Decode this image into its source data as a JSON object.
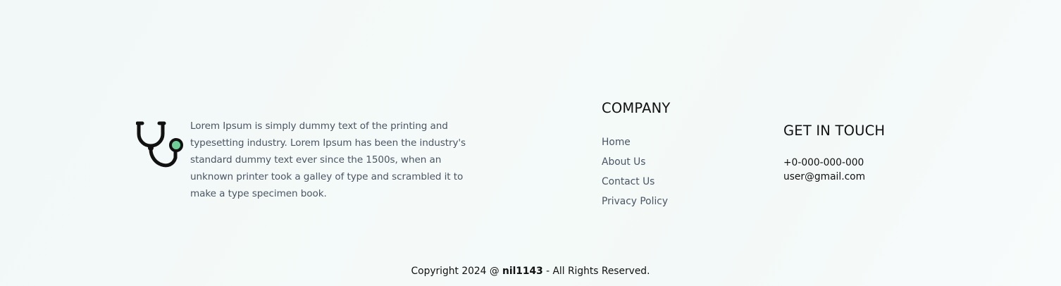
{
  "brand": {
    "logo_icon": "stethoscope-icon",
    "description": "Lorem Ipsum is simply dummy text of the printing and typesetting industry. Lorem Ipsum has been the industry's standard dummy text ever since the 1500s, when an unknown printer took a galley of type and scrambled it to make a type specimen book."
  },
  "company": {
    "heading": "COMPANY",
    "links": [
      {
        "label": "Home"
      },
      {
        "label": "About Us"
      },
      {
        "label": "Contact Us"
      },
      {
        "label": "Privacy Policy"
      }
    ]
  },
  "contact": {
    "heading": "GET IN TOUCH",
    "phone": "+0-000-000-000",
    "email": "user@gmail.com"
  },
  "footer": {
    "copyright_prefix": "Copyright 2024 @",
    "copyright_brand": "nil1143",
    "copyright_suffix": "- All Rights Reserved."
  },
  "colors": {
    "accent": "#6fcf97",
    "text": "#111111",
    "muted_text": "#4b5563"
  }
}
